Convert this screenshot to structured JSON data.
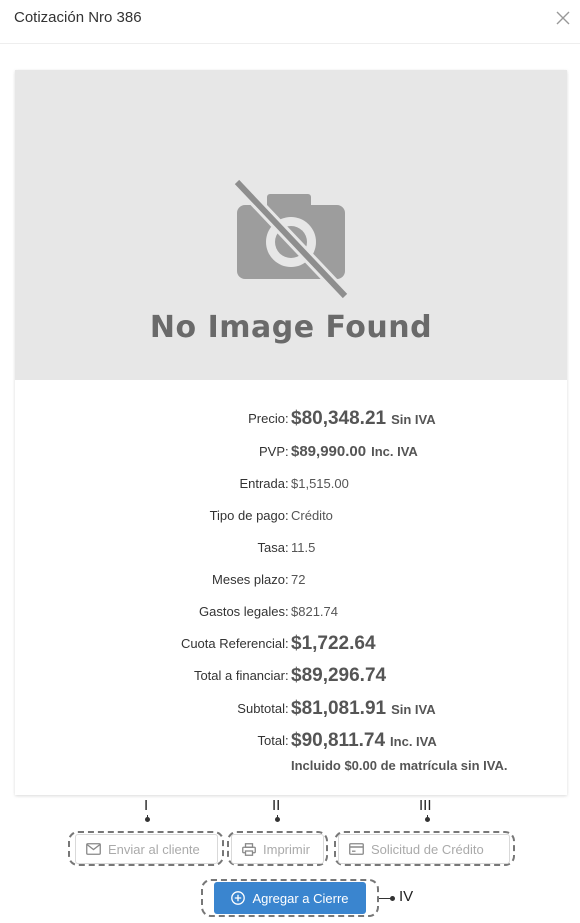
{
  "modal": {
    "title": "Cotización Nro 386"
  },
  "image": {
    "placeholder_text": "No Image Found",
    "icon": "camera-off-icon"
  },
  "details": [
    {
      "label": "Precio",
      "value": "$80,348.21",
      "suffix": "Sin IVA"
    },
    {
      "label": "PVP",
      "value": "$89,990.00",
      "suffix": "Inc. IVA"
    },
    {
      "label": "Entrada",
      "value": "$1,515.00",
      "suffix": ""
    },
    {
      "label": "Tipo de pago",
      "value": "Crédito",
      "suffix": ""
    },
    {
      "label": "Tasa",
      "value": "11.5",
      "suffix": ""
    },
    {
      "label": "Meses plazo",
      "value": "72",
      "suffix": ""
    },
    {
      "label": "Gastos legales",
      "value": "$821.74",
      "suffix": ""
    },
    {
      "label": "Cuota Referencial",
      "value": "$1,722.64",
      "suffix": ""
    },
    {
      "label": "Total a financiar",
      "value": "$89,296.74",
      "suffix": ""
    },
    {
      "label": "Subtotal",
      "value": "$81,081.91",
      "suffix": "Sin IVA"
    },
    {
      "label": "Total",
      "value": "$90,811.74",
      "suffix": "Inc. IVA"
    }
  ],
  "colon": ":",
  "note": "Incluido $0.00 de matrícula sin IVA.",
  "actions": {
    "send": {
      "label": "Enviar al cliente",
      "icon": "mail-icon"
    },
    "print": {
      "label": "Imprimir",
      "icon": "printer-icon"
    },
    "credit": {
      "label": "Solicitud de Crédito",
      "icon": "credit-card-icon"
    },
    "add_close": {
      "label": "Agregar a Cierre",
      "icon": "plus-circle-icon"
    }
  },
  "markers": {
    "m1": "I",
    "m2": "II",
    "m3": "III",
    "m4": "IV"
  },
  "colors": {
    "primary": "#3a85cf",
    "image_bg": "#e7e7e7"
  }
}
